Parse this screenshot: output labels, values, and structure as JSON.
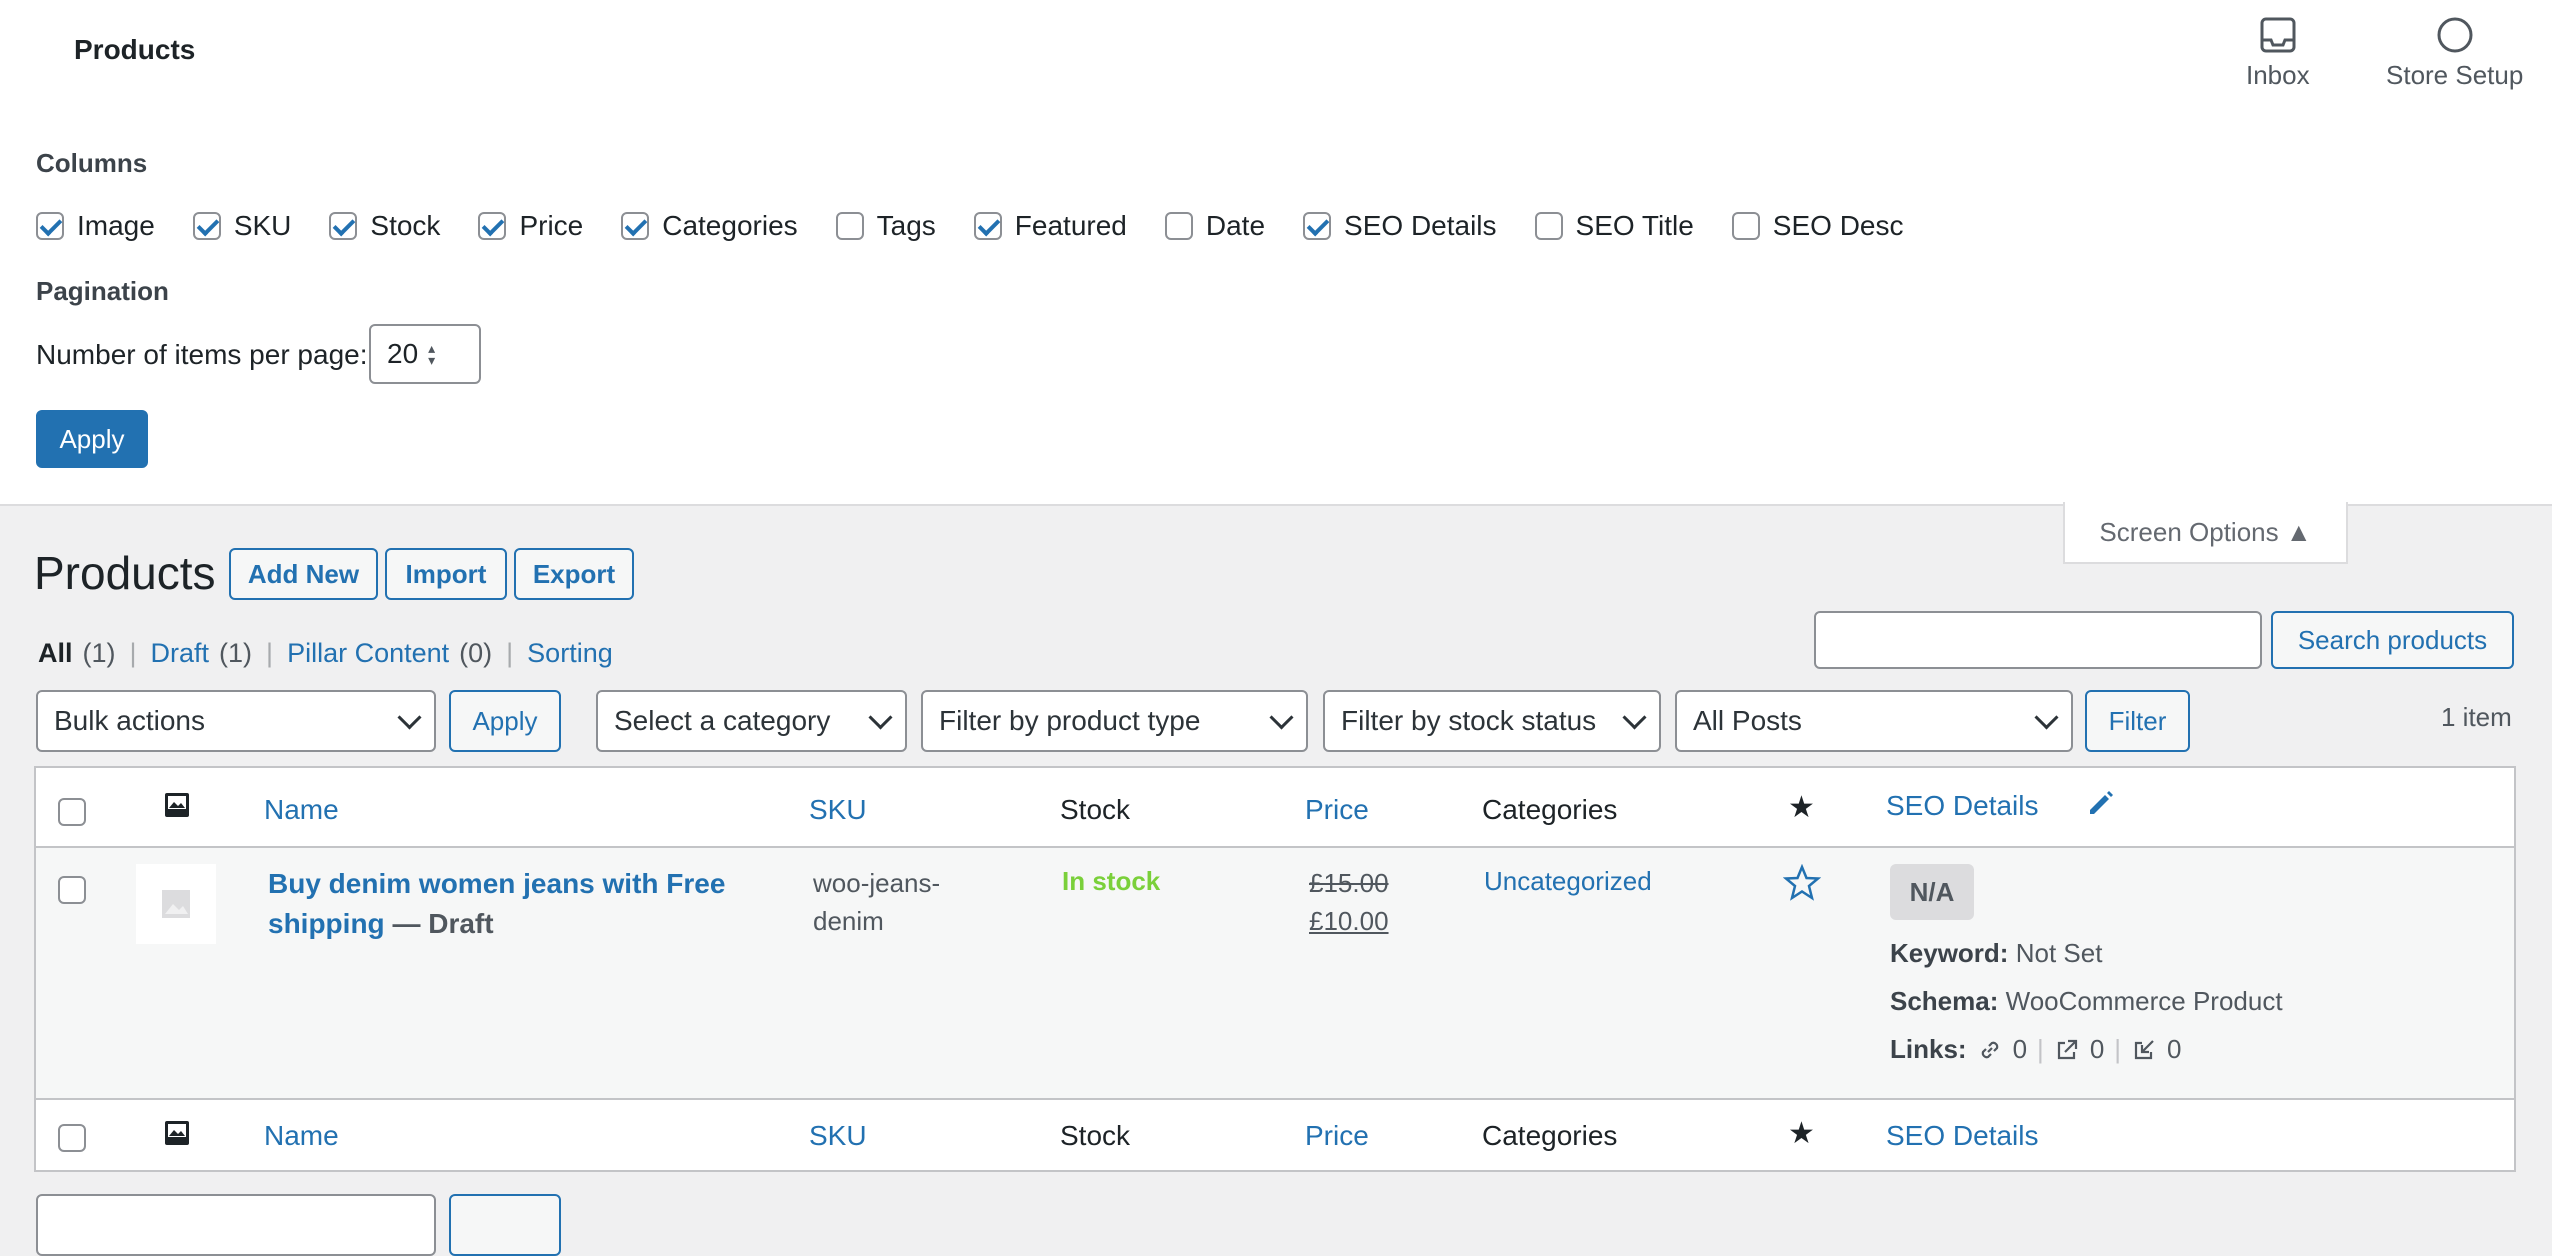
{
  "header": {
    "title": "Products",
    "inbox_label": "Inbox",
    "store_setup_label": "Store Setup"
  },
  "screen_options": {
    "columns_heading": "Columns",
    "columns": [
      {
        "label": "Image",
        "checked": true
      },
      {
        "label": "SKU",
        "checked": true
      },
      {
        "label": "Stock",
        "checked": true
      },
      {
        "label": "Price",
        "checked": true
      },
      {
        "label": "Categories",
        "checked": true
      },
      {
        "label": "Tags",
        "checked": false
      },
      {
        "label": "Featured",
        "checked": true
      },
      {
        "label": "Date",
        "checked": false
      },
      {
        "label": "SEO Details",
        "checked": true
      },
      {
        "label": "SEO Title",
        "checked": false
      },
      {
        "label": "SEO Desc",
        "checked": false
      }
    ],
    "pagination_heading": "Pagination",
    "items_per_page_label": "Number of items per page:",
    "items_per_page_value": "20",
    "apply_label": "Apply",
    "toggle_label": "Screen Options ▲"
  },
  "page": {
    "title": "Products",
    "add_new": "Add New",
    "import": "Import",
    "export": "Export"
  },
  "views": {
    "all": "All",
    "all_count": "(1)",
    "draft": "Draft",
    "draft_count": "(1)",
    "pillar": "Pillar Content",
    "pillar_count": "(0)",
    "sorting": "Sorting",
    "sep": "|"
  },
  "search": {
    "value": "",
    "button": "Search products"
  },
  "filters": {
    "bulk_actions": "Bulk actions",
    "apply": "Apply",
    "category": "Select a category",
    "product_type": "Filter by product type",
    "stock_status": "Filter by stock status",
    "posts": "All Posts",
    "filter_button": "Filter",
    "item_count": "1 item"
  },
  "table": {
    "columns": {
      "name": "Name",
      "sku": "SKU",
      "stock": "Stock",
      "price": "Price",
      "categories": "Categories",
      "seo": "SEO Details"
    },
    "rows": [
      {
        "name_line1": "Buy denim women jeans with Free",
        "name_line2": "shipping",
        "status": "— Draft",
        "sku_line1": "woo-jeans-",
        "sku_line2": "denim",
        "stock": "In stock",
        "price_old": "£15.00",
        "price_new": "£10.00",
        "category": "Uncategorized",
        "seo_badge": "N/A",
        "keyword_label": "Keyword:",
        "keyword_value": "Not Set",
        "schema_label": "Schema:",
        "schema_value": "WooCommerce Product",
        "links_label": "Links:",
        "internal_links": "0",
        "external_links": "0",
        "incoming_links": "0"
      }
    ]
  },
  "colors": {
    "accent": "#2271b1",
    "in_stock": "#7ad03a",
    "bg": "#f0f0f1"
  }
}
